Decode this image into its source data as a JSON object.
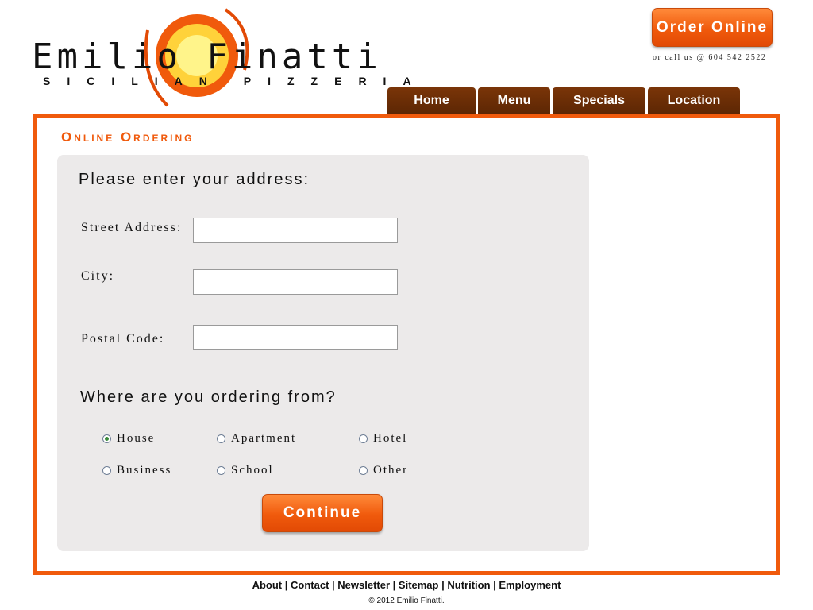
{
  "brand": {
    "name": "Emilio Finatti",
    "tagline": "SICILIAN PIZZERIA"
  },
  "header": {
    "order_online_label": "Order Online",
    "call_text": "or call us @ 604 542 2522"
  },
  "nav": {
    "items": [
      {
        "label": "Home"
      },
      {
        "label": "Menu"
      },
      {
        "label": "Specials"
      },
      {
        "label": "Location"
      }
    ]
  },
  "main": {
    "section_title": "Online Ordering",
    "address_prompt": "Please enter your address:",
    "fields": {
      "street": {
        "label": "Street Address:",
        "value": "",
        "placeholder": ""
      },
      "city": {
        "label": "City:",
        "value": "",
        "placeholder": ""
      },
      "postal": {
        "label": "Postal Code:",
        "value": "",
        "placeholder": ""
      }
    },
    "location_prompt": "Where are you ordering from?",
    "location_options": [
      {
        "label": "House",
        "selected": true
      },
      {
        "label": "Apartment",
        "selected": false
      },
      {
        "label": "Hotel",
        "selected": false
      },
      {
        "label": "Business",
        "selected": false
      },
      {
        "label": "School",
        "selected": false
      },
      {
        "label": "Other",
        "selected": false
      }
    ],
    "continue_label": "Continue"
  },
  "footer": {
    "links": [
      "About",
      "Contact",
      "Newsletter",
      "Sitemap",
      "Nutrition",
      "Employment"
    ],
    "separator": " | ",
    "copyright": "© 2012 Emilio Finatti."
  },
  "colors": {
    "accent": "#f05a0c",
    "nav_brown": "#6a2d06",
    "panel_bg": "#eceaea",
    "logo_yellow": "#ffe95a"
  },
  "icons": {
    "logo_mark": "sun-swirl-icon"
  }
}
